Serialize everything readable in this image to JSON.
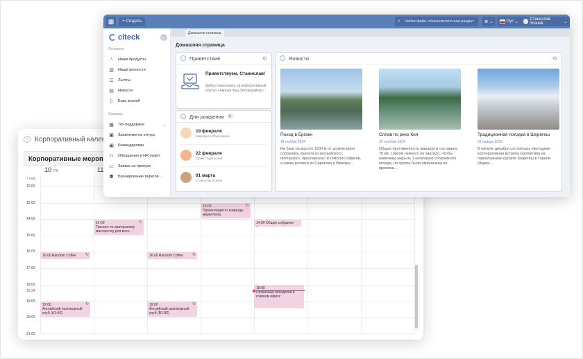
{
  "calendar": {
    "title": "Корпоративный календ",
    "subtitle": "Корпоративные мероприятия",
    "week_label": "7 нед",
    "days": [
      {
        "num": "10",
        "dow": "ПН"
      },
      {
        "num": "11",
        "dow": ""
      }
    ],
    "hours": [
      "12:00",
      "13:00",
      "14:00",
      "15:00",
      "16:00",
      "17:00",
      "18:00",
      "19:00",
      "20:00",
      "21:00"
    ],
    "now_time": "18:24",
    "events": [
      {
        "time": "13:00",
        "title": "Презентация от команды маркетинга"
      },
      {
        "time": "14:00",
        "title": "Тренинг по ораторскому мастерству для всех..."
      },
      {
        "time": "14:00",
        "title": "Общее собрание о..."
      },
      {
        "time": "16:00",
        "title": "Random Coffee"
      },
      {
        "time": "16:00",
        "title": "Random Coffee"
      },
      {
        "time": "18:00",
        "title": "Пятничные посиделки в главном офисе"
      },
      {
        "time": "19:00",
        "title": "Английский разговорный клуб (А1-А2)"
      },
      {
        "time": "19:00",
        "title": "Английский разговорный клуб (В1-В2)"
      }
    ]
  },
  "topbar": {
    "create_label": "Создать",
    "search_placeholder": "Найти файл, пользователя или раздел",
    "lang": "Рус",
    "user": "Станислав Усачев"
  },
  "sidebar": {
    "logo": "citeck",
    "section1": "Основное",
    "section2": "Сервисы",
    "items": [
      {
        "label": "Наши продукты",
        "icon": "org-chart-icon"
      },
      {
        "label": "Наши ценности",
        "icon": "building-icon"
      },
      {
        "label": "Льготы",
        "icon": "list-icon"
      },
      {
        "label": "Новости",
        "icon": "newspaper-icon"
      },
      {
        "label": "База знаний",
        "icon": "book-icon"
      }
    ],
    "services": [
      {
        "label": "Тех поддержка",
        "icon": "grid-icon"
      },
      {
        "label": "Заявления на отпуск",
        "icon": "briefcase-icon"
      },
      {
        "label": "Командировки",
        "icon": "suitcase-icon"
      },
      {
        "label": "Обращения в HR отдел",
        "icon": "people-icon"
      },
      {
        "label": "Заявка на пропуск",
        "icon": "card-icon"
      },
      {
        "label": "Бронирование перегов...",
        "icon": "meeting-icon"
      }
    ]
  },
  "page": {
    "tab": "Домашняя страница",
    "title": "Домашняя страница"
  },
  "greeting": {
    "header": "Приветствие",
    "title": "Приветствуем, Станислав!",
    "text": "Добро пожаловать на корпоративный портал «Аврора Фуд Энтерпрайзис»"
  },
  "birthdays": {
    "header": "Дни рождения",
    "count": "3",
    "items": [
      {
        "date": "19 февраля",
        "name": "Маргарита Ибрагимова"
      },
      {
        "date": "22 февраля",
        "name": "Ефим Подольский"
      },
      {
        "date": "01 марта",
        "name": "Станислав Усачев"
      }
    ]
  },
  "news": {
    "header": "Новости",
    "items": [
      {
        "title": "Поход в Ергаки",
        "date": "18 ноября 2024",
        "text": "На базе на высоте 1500 м от уровня моря собрались коллеги из московского, питерского, ярославского и томского офисов, а также коллеги из Саратова и Иматры..."
      },
      {
        "title": "Сплав по реке Кия",
        "date": "29 октября 2024",
        "text": "Общая протяженность маршрута составила 70 км, совсем немного не хватило, чтобы новичкам закрыть 1 категорию спортивного похода, но группа была ограничена во времени..."
      },
      {
        "title": "Традиционная поездка в Шерегеш",
        "date": "01 января 2025",
        "text": "В начале декабря состоялась ежегодная корпоративная встреча коллектива на горнолыжном курорте Шерегеш в Горной Шории..."
      }
    ]
  }
}
